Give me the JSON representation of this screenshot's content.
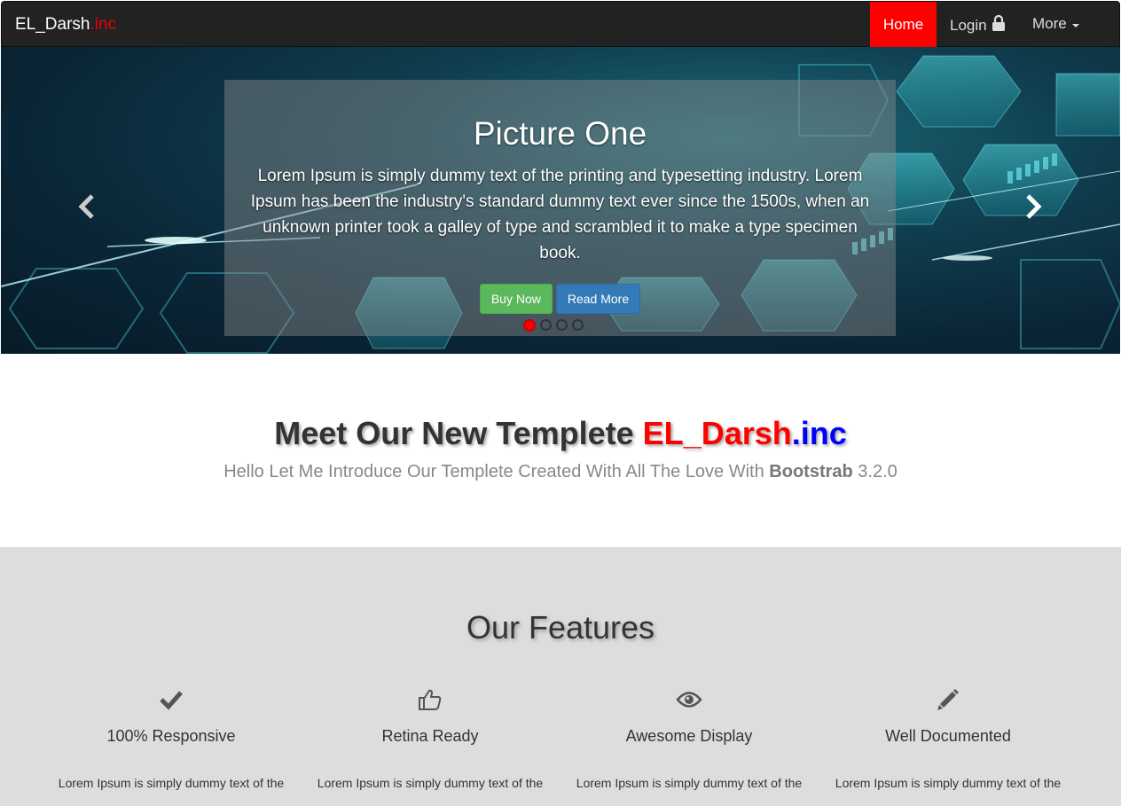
{
  "navbar": {
    "brand": "EL_Darsh",
    "brand_suffix": ".inc",
    "items": [
      {
        "label": "Home",
        "active": true
      },
      {
        "label": "Login",
        "icon": "lock-icon"
      },
      {
        "label": "More",
        "icon": "caret-down-icon"
      }
    ]
  },
  "carousel": {
    "title": "Picture One",
    "text": "Lorem Ipsum is simply dummy text of the printing and typesetting industry. Lorem Ipsum has been the industry's standard dummy text ever since the 1500s, when an unknown printer took a galley of type and scrambled it to make a type specimen book.",
    "buttons": {
      "buy": "Buy Now",
      "read": "Read More"
    },
    "indicator_count": 4,
    "active_index": 0
  },
  "intro": {
    "title_prefix": "Meet Our New Templete ",
    "title_brand": "EL_Darsh",
    "title_suffix": ".inc",
    "subtitle_prefix": "Hello Let Me Introduce Our Templete Created With All The Love With ",
    "subtitle_bold": "Bootstrab",
    "subtitle_version": " 3.2.0"
  },
  "features": {
    "title": "Our Features",
    "items": [
      {
        "name": "100% Responsive",
        "icon": "checkmark-icon",
        "text": "Lorem Ipsum is simply dummy text of the"
      },
      {
        "name": "Retina Ready",
        "icon": "thumbs-up-icon",
        "text": "Lorem Ipsum is simply dummy text of the"
      },
      {
        "name": "Awesome Display",
        "icon": "eye-icon",
        "text": "Lorem Ipsum is simply dummy text of the"
      },
      {
        "name": "Well Documented",
        "icon": "pencil-icon",
        "text": "Lorem Ipsum is simply dummy text of the"
      }
    ]
  },
  "colors": {
    "accent_red": "#ff0000",
    "accent_blue": "#0000ff",
    "navbar_bg": "#222222",
    "features_bg": "#dddddd"
  }
}
